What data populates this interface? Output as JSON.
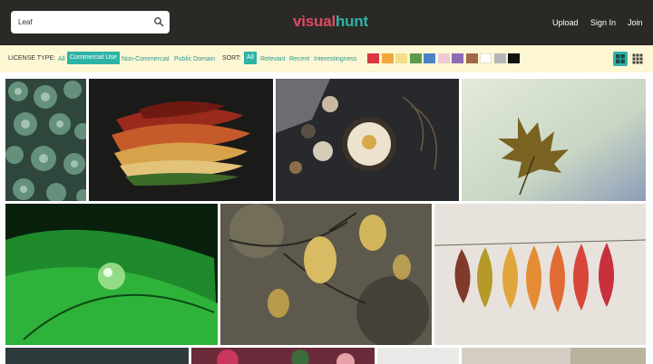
{
  "search": {
    "value": "Leaf",
    "icon": "search-icon"
  },
  "logo": {
    "part1": "visual",
    "part2": "hunt"
  },
  "nav": {
    "upload": "Upload",
    "signin": "Sign In",
    "join": "Join"
  },
  "filter": {
    "license_label": "LICENSE TYPE:",
    "license_options": [
      "All",
      "Commercial Use",
      "Non-Commercial",
      "Public Domain"
    ],
    "license_selected": "Commercial Use",
    "sort_label": "SORT:",
    "sort_options": [
      "All",
      "Relevant",
      "Recent",
      "Interestingness"
    ],
    "sort_selected": "All",
    "colors": [
      "#d9363e",
      "#f2a93b",
      "#f3de8a",
      "#5e9a4e",
      "#4a82c9",
      "#f0c9d6",
      "#8c6bb8",
      "#a0674b",
      "#ffffff",
      "#b5b5b5",
      "#111111"
    ],
    "view_options": [
      "grid-large-icon",
      "grid-small-icon"
    ],
    "view_selected": "grid-large-icon"
  },
  "photos": [
    {
      "subject": "succulents"
    },
    {
      "subject": "dried-leaves-stack"
    },
    {
      "subject": "cake-flatlay"
    },
    {
      "subject": "autumn-maple-leaf"
    },
    {
      "subject": "green-leaf-droplet"
    },
    {
      "subject": "yellow-leaves-branch"
    },
    {
      "subject": "colorful-leaves-string"
    },
    {
      "subject": "row3-photo-1"
    },
    {
      "subject": "row3-photo-2"
    },
    {
      "subject": "row3-photo-3"
    },
    {
      "subject": "row3-photo-4"
    }
  ]
}
